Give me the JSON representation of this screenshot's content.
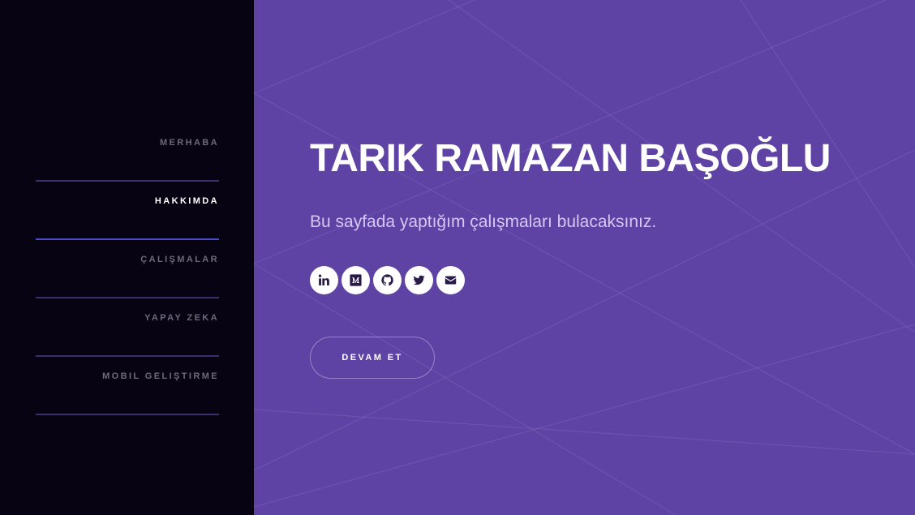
{
  "sidebar": {
    "items": [
      {
        "label": "MERHABA",
        "active": false
      },
      {
        "label": "HAKKIMDA",
        "active": true
      },
      {
        "label": "ÇALIŞMALAR",
        "active": false
      },
      {
        "label": "YAPAY ZEKA",
        "active": false
      },
      {
        "label": "MOBIL GELIŞTIRME",
        "active": false
      }
    ]
  },
  "hero": {
    "title": "TARIK RAMAZAN BAŞOĞLU",
    "subtitle": "Bu sayfada yaptığım çalışmaları bulacaksınız.",
    "cta_label": "DEVAM ET"
  },
  "socials": [
    {
      "icon": "linkedin-icon"
    },
    {
      "icon": "medium-icon"
    },
    {
      "icon": "github-icon"
    },
    {
      "icon": "twitter-icon"
    },
    {
      "icon": "email-icon"
    }
  ],
  "colors": {
    "sidebar_bg": "#070313",
    "main_bg": "#5e43a5",
    "active_underline": "#4a4cc8",
    "divider": "#3a2f6b",
    "icon_color": "#2a1a4a"
  }
}
